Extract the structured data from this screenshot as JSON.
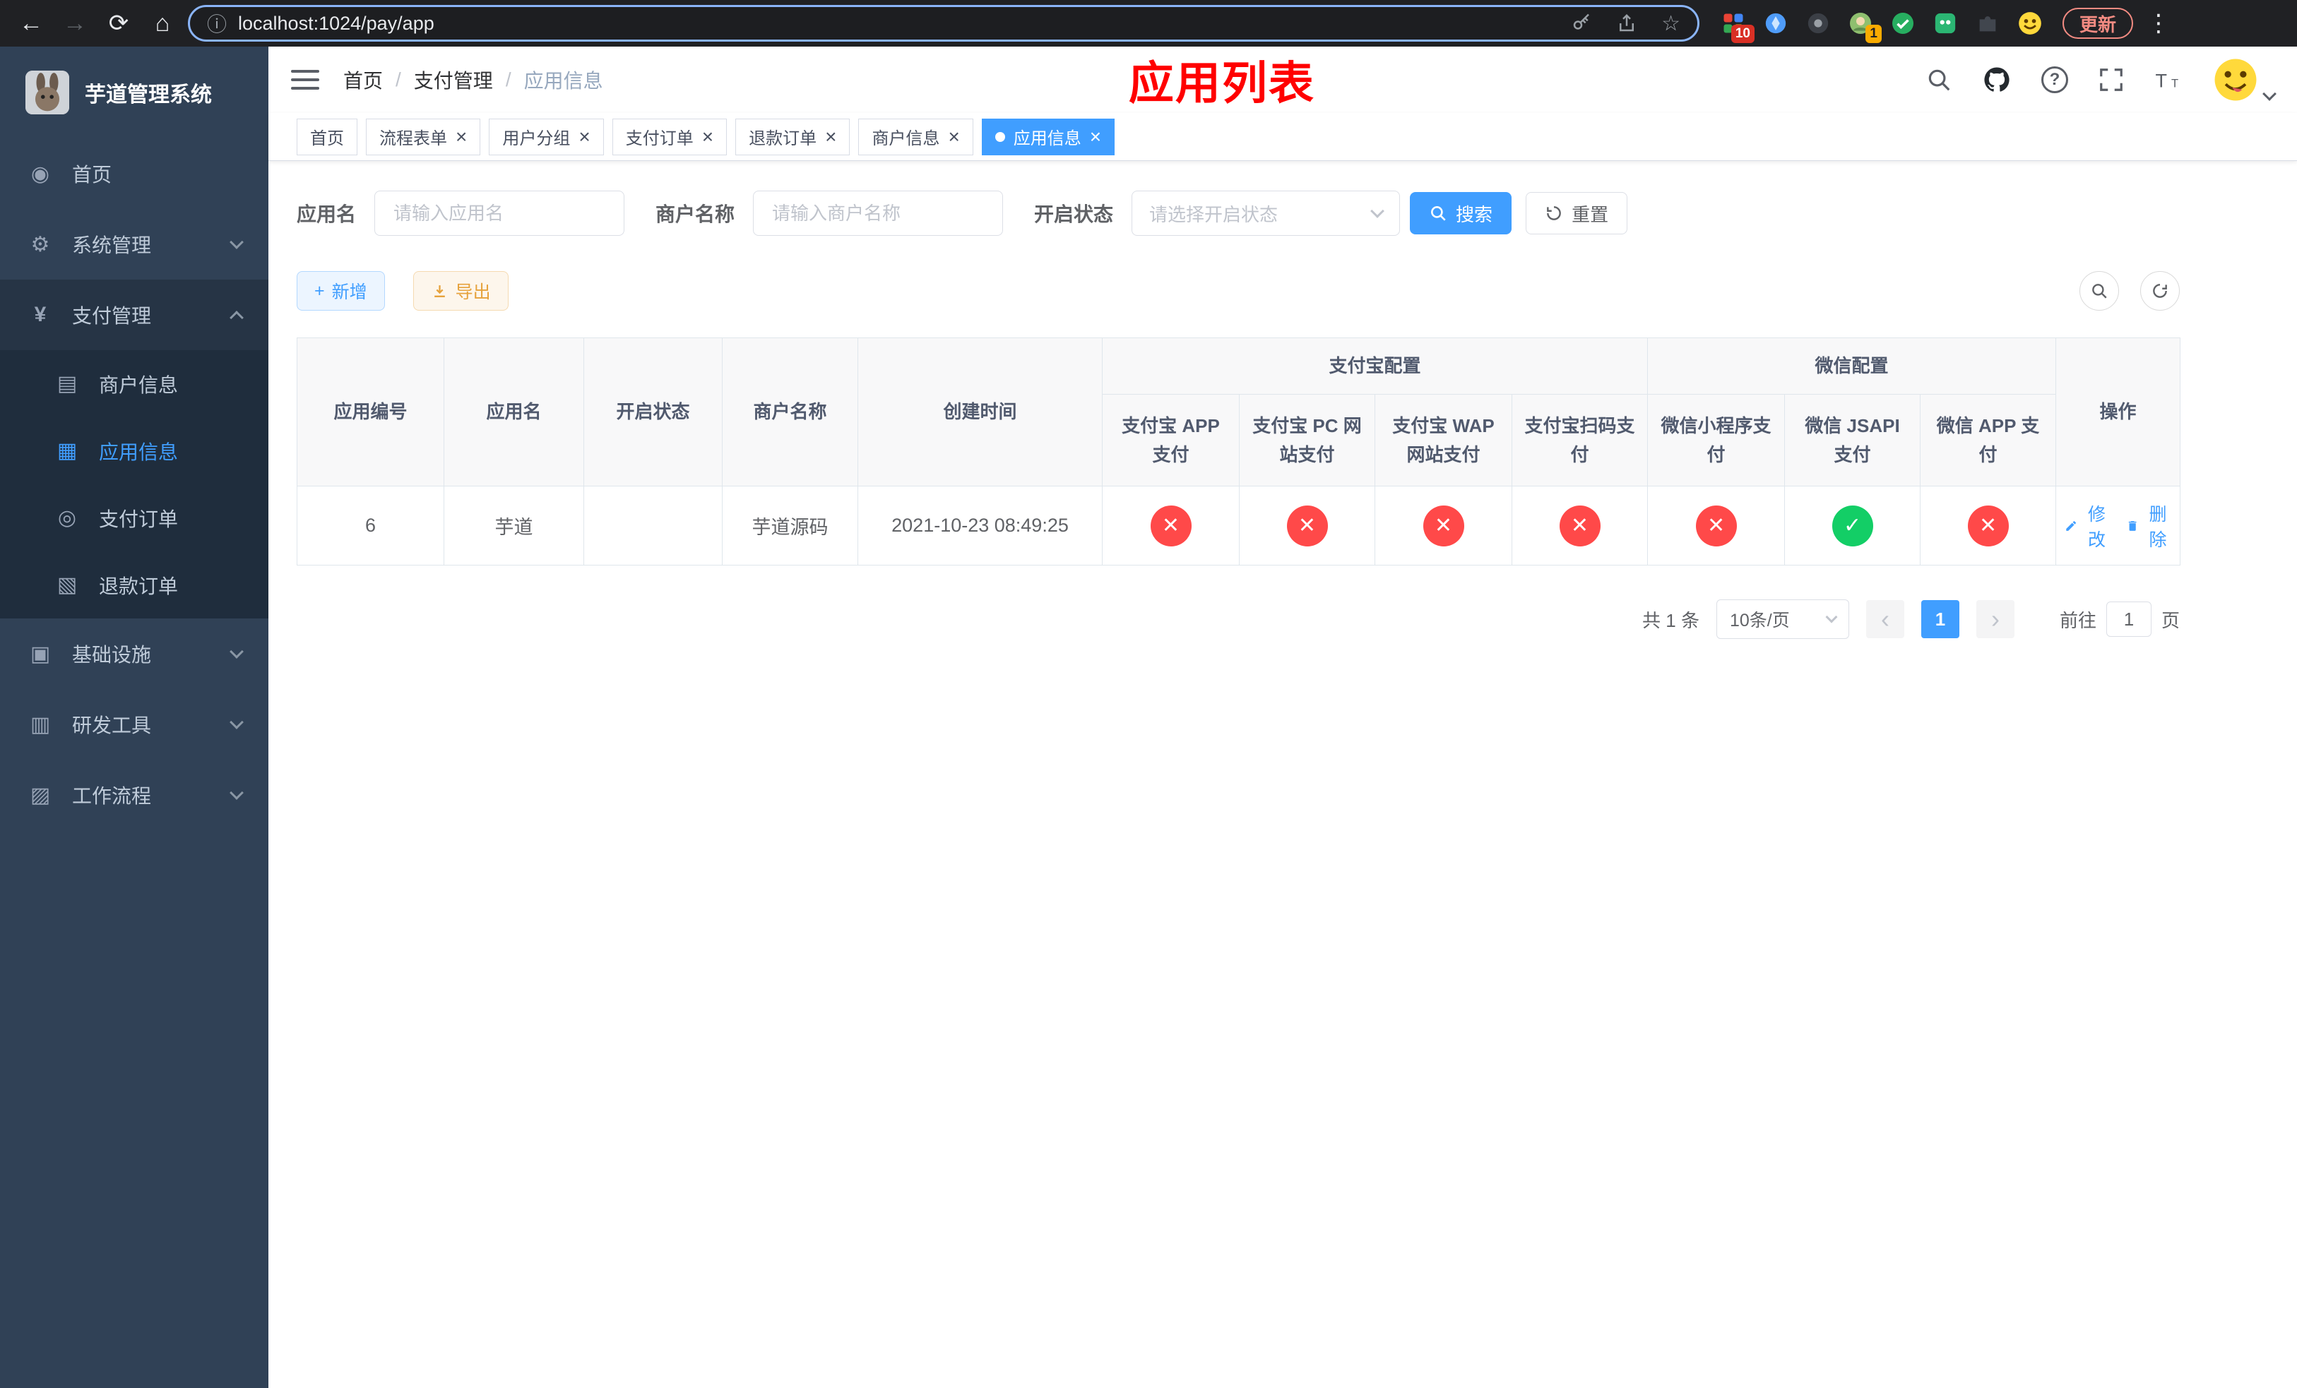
{
  "colors": {
    "accent": "#409eff",
    "success": "#13ce66",
    "danger": "#ff4949",
    "title_red": "#ff0000",
    "sidebar_bg": "#304156",
    "submenu_bg": "#1f2d3d"
  },
  "icons": {
    "yes": "✓",
    "no": "✕"
  },
  "browser": {
    "url": "localhost:1024/pay/app",
    "update_label": "更新",
    "ext_badge_grid": "10",
    "ext_badge_avatar": "1"
  },
  "sidebar": {
    "title": "芋道管理系统",
    "home": "首页",
    "system": "系统管理",
    "payment": "支付管理",
    "payment_children": [
      "商户信息",
      "应用信息",
      "支付订单",
      "退款订单"
    ],
    "infra": "基础设施",
    "devtools": "研发工具",
    "workflow": "工作流程"
  },
  "header": {
    "breadcrumb": [
      "首页",
      "支付管理",
      "应用信息"
    ],
    "title": "应用列表"
  },
  "tabs": [
    {
      "label": "首页",
      "closable": false,
      "active": false
    },
    {
      "label": "流程表单",
      "closable": true,
      "active": false
    },
    {
      "label": "用户分组",
      "closable": true,
      "active": false
    },
    {
      "label": "支付订单",
      "closable": true,
      "active": false
    },
    {
      "label": "退款订单",
      "closable": true,
      "active": false
    },
    {
      "label": "商户信息",
      "closable": true,
      "active": false
    },
    {
      "label": "应用信息",
      "closable": true,
      "active": true
    }
  ],
  "filters": {
    "app_name_label": "应用名",
    "app_name_placeholder": "请输入应用名",
    "merchant_label": "商户名称",
    "merchant_placeholder": "请输入商户名称",
    "status_label": "开启状态",
    "status_placeholder": "请选择开启状态",
    "search_label": "搜索",
    "reset_label": "重置"
  },
  "actions": {
    "add_label": "新增",
    "export_label": "导出"
  },
  "table": {
    "groups": {
      "alipay": "支付宝配置",
      "wechat": "微信配置"
    },
    "columns": [
      "应用编号",
      "应用名",
      "开启状态",
      "商户名称",
      "创建时间",
      "支付宝 APP 支付",
      "支付宝 PC 网站支付",
      "支付宝 WAP 网站支付",
      "支付宝扫码支付",
      "微信小程序支付",
      "微信 JSAPI 支付",
      "微信 APP 支付",
      "操作"
    ],
    "rows": [
      {
        "id": "6",
        "name": "芋道",
        "enabled": true,
        "merchant": "芋道源码",
        "created": "2021-10-23 08:49:25",
        "statuses": {
          "alipay_app": false,
          "alipay_pc": false,
          "alipay_wap": false,
          "alipay_qr": false,
          "wechat_mini": false,
          "wechat_jsapi": true,
          "wechat_app": false
        },
        "actions": {
          "edit": "修改",
          "delete": "删除"
        }
      }
    ]
  },
  "pagination": {
    "total": "共 1 条",
    "page_size": "10条/页",
    "current_page": "1",
    "goto_prefix": "前往",
    "goto_value": "1",
    "goto_suffix": "页"
  }
}
